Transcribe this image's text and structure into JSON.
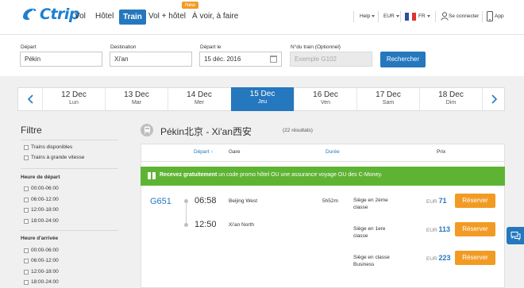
{
  "header": {
    "logo_text": "Ctrip",
    "nav": [
      "Vol",
      "Hôtel",
      "Train",
      "Vol + hôtel",
      "À voir, à faire"
    ],
    "new_badge": "New",
    "help": "Help",
    "currency": "EUR",
    "language": "FR",
    "login": "Se connecter",
    "app": "App"
  },
  "search": {
    "departure_label": "Départ",
    "departure_value": "Pékin",
    "destination_label": "Destination",
    "destination_value": "Xi'an",
    "date_label": "Départ le",
    "date_value": "15 déc. 2016",
    "train_label": "N°du train (Optionnel)",
    "train_placeholder": "Exemple G102",
    "button": "Rechercher"
  },
  "dates": [
    {
      "day": "12 Dec",
      "weekday": "Lun"
    },
    {
      "day": "13 Dec",
      "weekday": "Mar"
    },
    {
      "day": "14 Dec",
      "weekday": "Mer"
    },
    {
      "day": "15 Dec",
      "weekday": "Jeu",
      "active": true
    },
    {
      "day": "16 Dec",
      "weekday": "Ven"
    },
    {
      "day": "17 Dec",
      "weekday": "Sam"
    },
    {
      "day": "18 Dec",
      "weekday": "Dim"
    }
  ],
  "filters": {
    "title": "Filtre",
    "train_types": [
      "Trains disponibles",
      "Trains à grande vitesse"
    ],
    "departure_title": "Heure de départ",
    "departure_slots": [
      "00:00-06:00",
      "06:00-12:00",
      "12:00-18:00",
      "18:00-24:00"
    ],
    "arrival_title": "Heure d'arrivée",
    "arrival_slots": [
      "00:00-06:00",
      "06:00-12:00",
      "12:00-18:00",
      "18:00-24:00"
    ]
  },
  "results": {
    "route": "Pékin北京 - Xi'an西安",
    "count": "(22 résultats)",
    "columns": {
      "departure": "Départ ↑",
      "station": "Gare",
      "duration": "Durée",
      "price": "Prix"
    },
    "promo_bold": "Recevez gratuitement",
    "promo_text": " un code promo hôtel OU une assurance voyage OU des C-Money.",
    "train": {
      "number": "G651",
      "depart_time": "06:58",
      "depart_station": "Beijing West",
      "arrive_time": "12:50",
      "arrive_station": "Xi'an North",
      "duration": "5h52m"
    },
    "fares": [
      {
        "class": "Siège en 2ème classe",
        "currency": "EUR",
        "amount": "71",
        "button": "Réserver"
      },
      {
        "class": "Siège en 1ere classe",
        "currency": "EUR",
        "amount": "113",
        "button": "Réserver"
      },
      {
        "class": "Siège en classe Business",
        "currency": "EUR",
        "amount": "223",
        "button": "Réserver"
      }
    ]
  },
  "colors": {
    "primary": "#2577be",
    "accent": "#f29b24",
    "promo": "#5eb432"
  }
}
